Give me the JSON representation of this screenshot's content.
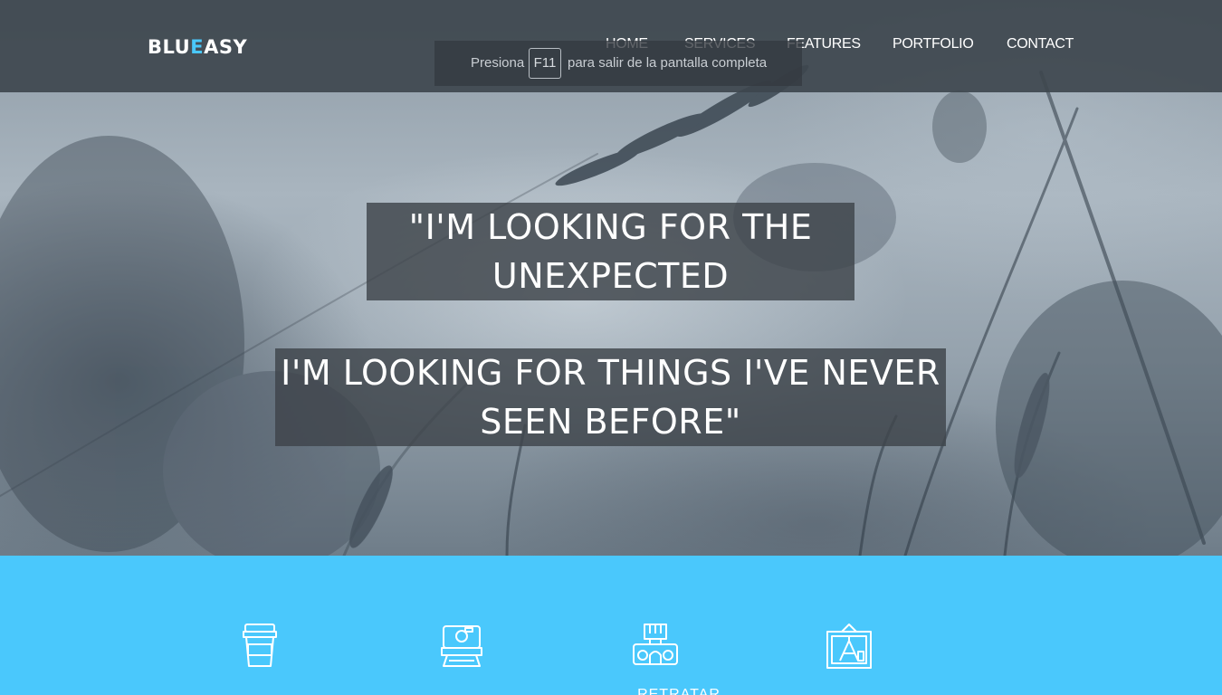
{
  "brand": {
    "prefix": "BLU",
    "accent": "E",
    "suffix": "ASY",
    "accent_color": "#4ac8fc"
  },
  "nav": {
    "items": [
      {
        "label": "HOME"
      },
      {
        "label": "SERVICES"
      },
      {
        "label": "FEATURES"
      },
      {
        "label": "PORTFOLIO"
      },
      {
        "label": "CONTACT"
      }
    ]
  },
  "fullscreen_notice": {
    "before": "Presiona",
    "key": "F11",
    "after": "para salir de la pantalla completa"
  },
  "hero": {
    "quote_1": [
      "\"I'M LOOKING FOR THE",
      "UNEXPECTED"
    ],
    "quote_2": [
      "I'M LOOKING FOR THINGS I'VE NEVER",
      "SEEN BEFORE\""
    ]
  },
  "features": {
    "background_color": "#4ac8fc",
    "items": [
      {
        "icon": "coffee-cup-icon",
        "label": ""
      },
      {
        "icon": "instant-camera-icon",
        "label": ""
      },
      {
        "icon": "vintage-camera-icon",
        "label": "RETRATAR"
      },
      {
        "icon": "framed-picture-icon",
        "label": ""
      }
    ]
  }
}
